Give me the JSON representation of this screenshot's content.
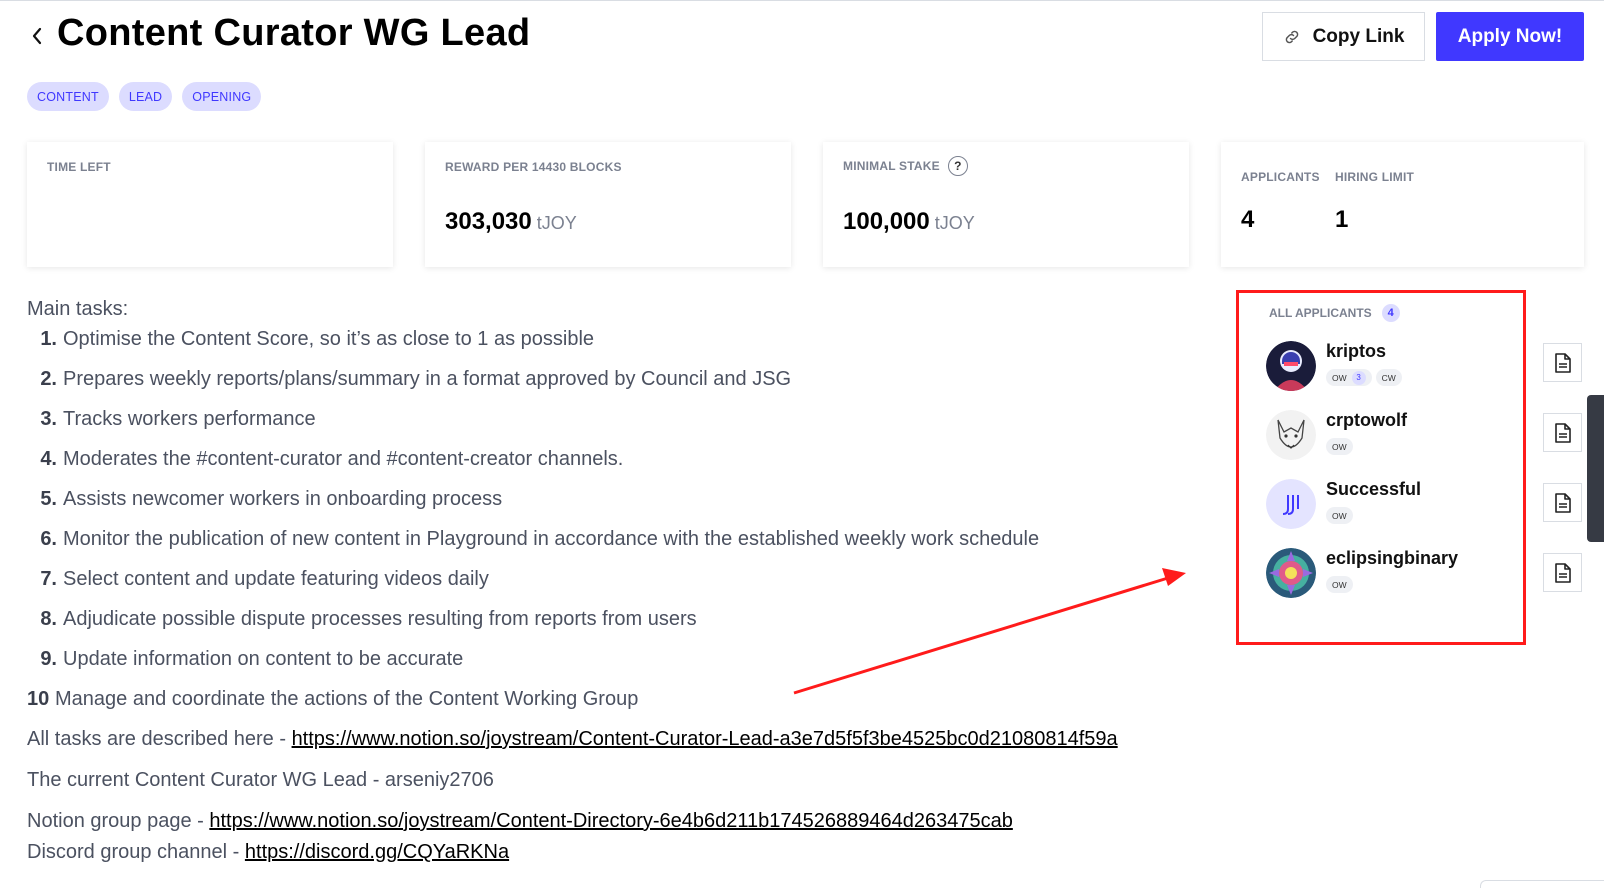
{
  "header": {
    "title": "Content Curator WG Lead",
    "copy_link_label": "Copy Link",
    "apply_label": "Apply Now!"
  },
  "tags": [
    "CONTENT",
    "LEAD",
    "OPENING"
  ],
  "stats": {
    "time_left_label": "TIME LEFT",
    "reward_label": "REWARD PER 14430 BLOCKS",
    "reward_value": "303,030",
    "reward_unit": "tJOY",
    "stake_label": "MINIMAL STAKE",
    "stake_help": "?",
    "stake_value": "100,000",
    "stake_unit": "tJOY",
    "applicants_label": "APPLICANTS",
    "applicants_value": "4",
    "hiring_limit_label": "HIRING LIMIT",
    "hiring_limit_value": "1"
  },
  "description": {
    "heading": "Main tasks:",
    "tasks": [
      {
        "num": "1.",
        "text": "Optimise the Content Score, so it’s as close to 1 as possible"
      },
      {
        "num": "2.",
        "text": "Prepares weekly reports/plans/summary in a format approved by Council and JSG"
      },
      {
        "num": "3.",
        "text": "Tracks workers performance"
      },
      {
        "num": "4.",
        "text": "Moderates the #content-curator and #content-creator channels."
      },
      {
        "num": "5.",
        "text": "Assists newcomer workers in onboarding process"
      },
      {
        "num": "6.",
        "text": "Monitor the publication of new content in Playground in accordance with the established weekly work schedule"
      },
      {
        "num": "7.",
        "text": "Select content and update featuring videos daily"
      },
      {
        "num": "8.",
        "text": "Adjudicate possible dispute processes resulting from reports from users"
      },
      {
        "num": "9.",
        "text": "Update information on content to be accurate"
      },
      {
        "num": "10",
        "text": "Manage and coordinate the actions of the Content Working Group"
      }
    ],
    "all_tasks_prefix": "All tasks are described here - ",
    "all_tasks_link": "https://www.notion.so/joystream/Content-Curator-Lead-a3e7d5f5f3be4525bc0d21080814f59a",
    "current_lead": "The current Content Curator WG Lead - arseniy2706",
    "notion_prefix": "Notion group page - ",
    "notion_link": "https://www.notion.so/joystream/Content-Directory-6e4b6d211b174526889464d263475cab",
    "discord_prefix": "Discord group channel - ",
    "discord_link": "https://discord.gg/CQYaRKNa"
  },
  "applicants_panel": {
    "header": "ALL APPLICANTS",
    "count": "4",
    "applicants": [
      {
        "name": "kriptos",
        "badges": [
          {
            "label": "OW",
            "count": "3"
          },
          {
            "label": "CW"
          }
        ]
      },
      {
        "name": "crptowolf",
        "badges": [
          {
            "label": "OW"
          }
        ]
      },
      {
        "name": "Successful",
        "badges": [
          {
            "label": "OW"
          }
        ]
      },
      {
        "name": "eclipsingbinary",
        "badges": [
          {
            "label": "OW"
          }
        ]
      }
    ]
  },
  "colors": {
    "accent": "#4038ff",
    "tag_bg": "#dcdcff",
    "highlight": "#ff1b1b",
    "muted_text": "#7b8190"
  }
}
